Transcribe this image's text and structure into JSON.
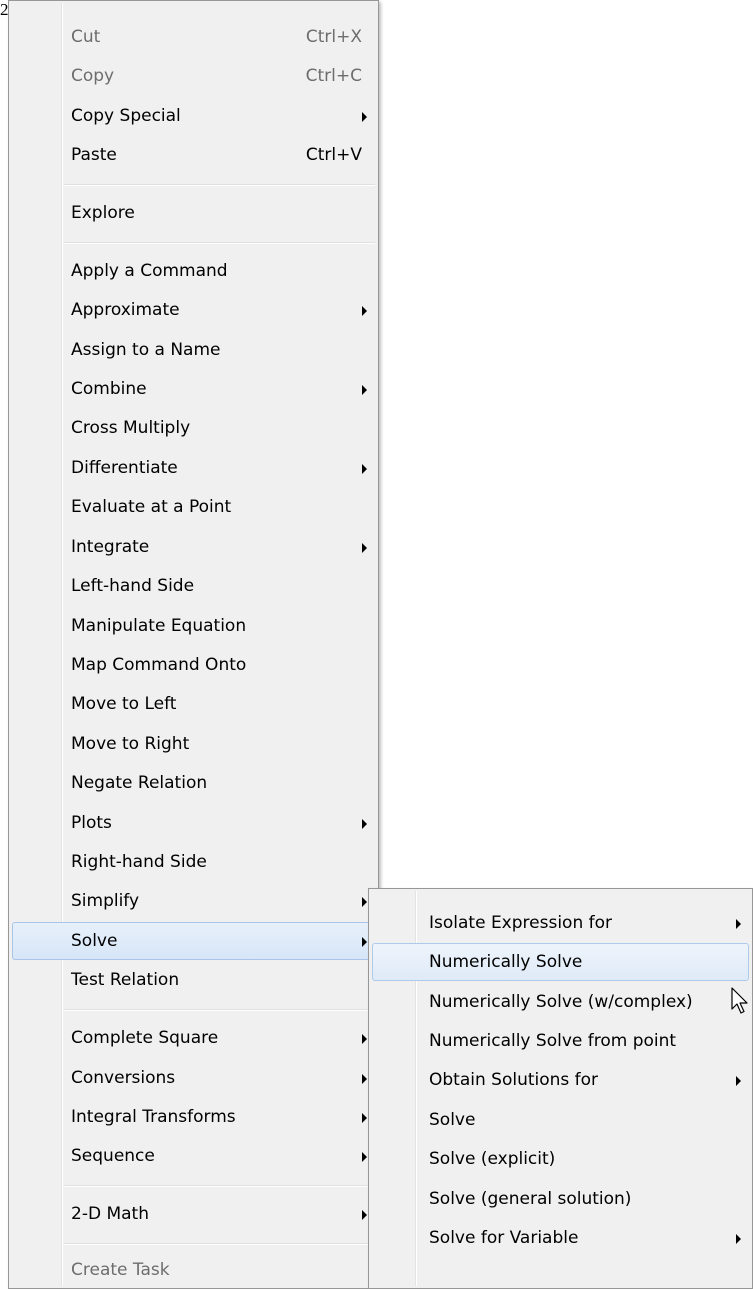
{
  "corner_text": "2",
  "main_menu": {
    "items": [
      {
        "label": "Cut",
        "shortcut": "Ctrl+X",
        "disabled": true,
        "submenu": false
      },
      {
        "label": "Copy",
        "shortcut": "Ctrl+C",
        "disabled": true,
        "submenu": false
      },
      {
        "label": "Copy Special",
        "shortcut": "",
        "disabled": false,
        "submenu": true
      },
      {
        "label": "Paste",
        "shortcut": "Ctrl+V",
        "disabled": false,
        "submenu": false
      },
      {
        "label": "Explore",
        "shortcut": "",
        "disabled": false,
        "submenu": false
      },
      {
        "label": "Apply a Command",
        "shortcut": "",
        "disabled": false,
        "submenu": false
      },
      {
        "label": "Approximate",
        "shortcut": "",
        "disabled": false,
        "submenu": true
      },
      {
        "label": "Assign to a Name",
        "shortcut": "",
        "disabled": false,
        "submenu": false
      },
      {
        "label": "Combine",
        "shortcut": "",
        "disabled": false,
        "submenu": true
      },
      {
        "label": "Cross Multiply",
        "shortcut": "",
        "disabled": false,
        "submenu": false
      },
      {
        "label": "Differentiate",
        "shortcut": "",
        "disabled": false,
        "submenu": true
      },
      {
        "label": "Evaluate at a Point",
        "shortcut": "",
        "disabled": false,
        "submenu": false
      },
      {
        "label": "Integrate",
        "shortcut": "",
        "disabled": false,
        "submenu": true
      },
      {
        "label": "Left-hand Side",
        "shortcut": "",
        "disabled": false,
        "submenu": false
      },
      {
        "label": "Manipulate Equation",
        "shortcut": "",
        "disabled": false,
        "submenu": false
      },
      {
        "label": "Map Command Onto",
        "shortcut": "",
        "disabled": false,
        "submenu": false
      },
      {
        "label": "Move to Left",
        "shortcut": "",
        "disabled": false,
        "submenu": false
      },
      {
        "label": "Move to Right",
        "shortcut": "",
        "disabled": false,
        "submenu": false
      },
      {
        "label": "Negate Relation",
        "shortcut": "",
        "disabled": false,
        "submenu": false
      },
      {
        "label": "Plots",
        "shortcut": "",
        "disabled": false,
        "submenu": true
      },
      {
        "label": "Right-hand Side",
        "shortcut": "",
        "disabled": false,
        "submenu": false
      },
      {
        "label": "Simplify",
        "shortcut": "",
        "disabled": false,
        "submenu": true
      },
      {
        "label": "Solve",
        "shortcut": "",
        "disabled": false,
        "submenu": true,
        "selected": true
      },
      {
        "label": "Test Relation",
        "shortcut": "",
        "disabled": false,
        "submenu": false
      },
      {
        "label": "Complete Square",
        "shortcut": "",
        "disabled": false,
        "submenu": true
      },
      {
        "label": "Conversions",
        "shortcut": "",
        "disabled": false,
        "submenu": true
      },
      {
        "label": "Integral Transforms",
        "shortcut": "",
        "disabled": false,
        "submenu": true
      },
      {
        "label": "Sequence",
        "shortcut": "",
        "disabled": false,
        "submenu": true
      },
      {
        "label": "2-D Math",
        "shortcut": "",
        "disabled": false,
        "submenu": true
      },
      {
        "label": "Create Task",
        "shortcut": "",
        "disabled": true,
        "submenu": false
      }
    ]
  },
  "solve_submenu": {
    "items": [
      {
        "label": "Isolate Expression for",
        "submenu": true
      },
      {
        "label": "Numerically Solve",
        "submenu": false,
        "hovered": true
      },
      {
        "label": "Numerically Solve (w/complex)",
        "submenu": false
      },
      {
        "label": "Numerically Solve from point",
        "submenu": false
      },
      {
        "label": "Obtain Solutions for",
        "submenu": true
      },
      {
        "label": "Solve",
        "submenu": false
      },
      {
        "label": "Solve (explicit)",
        "submenu": false
      },
      {
        "label": "Solve (general solution)",
        "submenu": false
      },
      {
        "label": "Solve for Variable",
        "submenu": true
      }
    ]
  },
  "colors": {
    "menu_background": "#f0f0f0",
    "selected_background": "#dae7f7",
    "selected_border": "#a8c5e8",
    "disabled_text": "#6d6d6d"
  }
}
